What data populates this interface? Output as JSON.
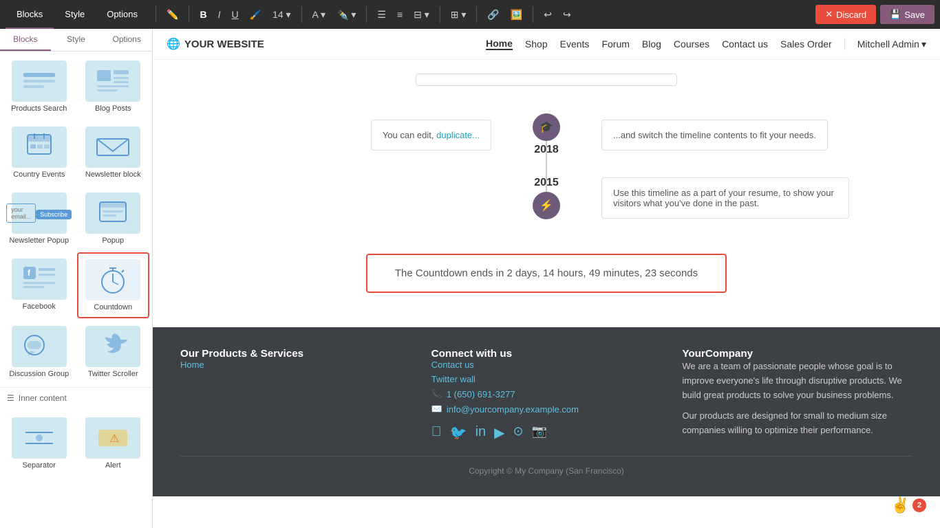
{
  "toolbar": {
    "tabs": [
      "Blocks",
      "Style",
      "Options"
    ],
    "active_tab": "Blocks",
    "icons": [
      "✏️",
      "B",
      "I",
      "U",
      "🖌️",
      "14",
      "A",
      "🖊️",
      "☰",
      "☰",
      "⬚",
      "⊞",
      "🔗",
      "📋",
      "↩",
      "↪"
    ],
    "discard_label": "Discard",
    "save_label": "Save"
  },
  "sidebar": {
    "sections": [
      {
        "items": [
          {
            "id": "products-search",
            "label": "Products Search",
            "icon": "🔍"
          },
          {
            "id": "blog-posts",
            "label": "Blog Posts",
            "icon": "📝"
          },
          {
            "id": "country-events",
            "label": "Country Events",
            "icon": "🎫"
          },
          {
            "id": "newsletter-block",
            "label": "Newsletter block",
            "icon": "📰"
          },
          {
            "id": "newsletter-popup",
            "label": "Newsletter Popup",
            "icon": "📧"
          },
          {
            "id": "popup",
            "label": "Popup",
            "icon": "🪟"
          },
          {
            "id": "facebook",
            "label": "Facebook",
            "icon": "f"
          },
          {
            "id": "countdown",
            "label": "Countdown",
            "icon": "⏱",
            "selected": true
          },
          {
            "id": "discussion-group",
            "label": "Discussion Group",
            "icon": "💬"
          },
          {
            "id": "twitter-scroller",
            "label": "Twitter Scroller",
            "icon": "🐦"
          }
        ]
      }
    ],
    "inner_content_label": "Inner content",
    "sub_items": [
      {
        "id": "separator",
        "label": "Separator",
        "icon": "—"
      },
      {
        "id": "alert",
        "label": "Alert",
        "icon": "⚠️"
      }
    ]
  },
  "nav": {
    "brand": "YOUR WEBSITE",
    "links": [
      "Home",
      "Shop",
      "Events",
      "Forum",
      "Blog",
      "Courses",
      "Contact us",
      "Sales Order"
    ],
    "active_link": "Home",
    "user": "Mitchell Admin"
  },
  "timeline": {
    "input_placeholder": "",
    "rows": [
      {
        "left_text": "You can edit, duplicate...",
        "year": "2018",
        "icon": "🎓",
        "right_text": "...and switch the timeline contents to fit your needs."
      },
      {
        "left_text": "",
        "year": "2015",
        "icon": "⚡",
        "right_text": "Use this timeline as a part of your resume, to show your visitors what you've done in the past."
      }
    ]
  },
  "countdown": {
    "text": "The Countdown ends in 2 days, 14 hours, 49 minutes, 23 seconds"
  },
  "footer": {
    "col1_title": "Our Products & Services",
    "col1_links": [
      "Home"
    ],
    "col2_title": "Connect with us",
    "col2_contact_link": "Contact us",
    "col2_twitter": "Twitter wall",
    "col2_phone": "1 (650) 691-3277",
    "col2_email": "info@yourcompany.example.com",
    "col3_title": "YourCompany",
    "col3_text1": "We are a team of passionate people whose goal is to improve everyone's life through disruptive products. We build great products to solve your business problems.",
    "col3_text2": "Our products are designed for small to medium size companies willing to optimize their performance.",
    "copyright": "Copyright © My Company (San Francisco)"
  },
  "badge": {
    "emoji": "✌️",
    "count": "2"
  }
}
